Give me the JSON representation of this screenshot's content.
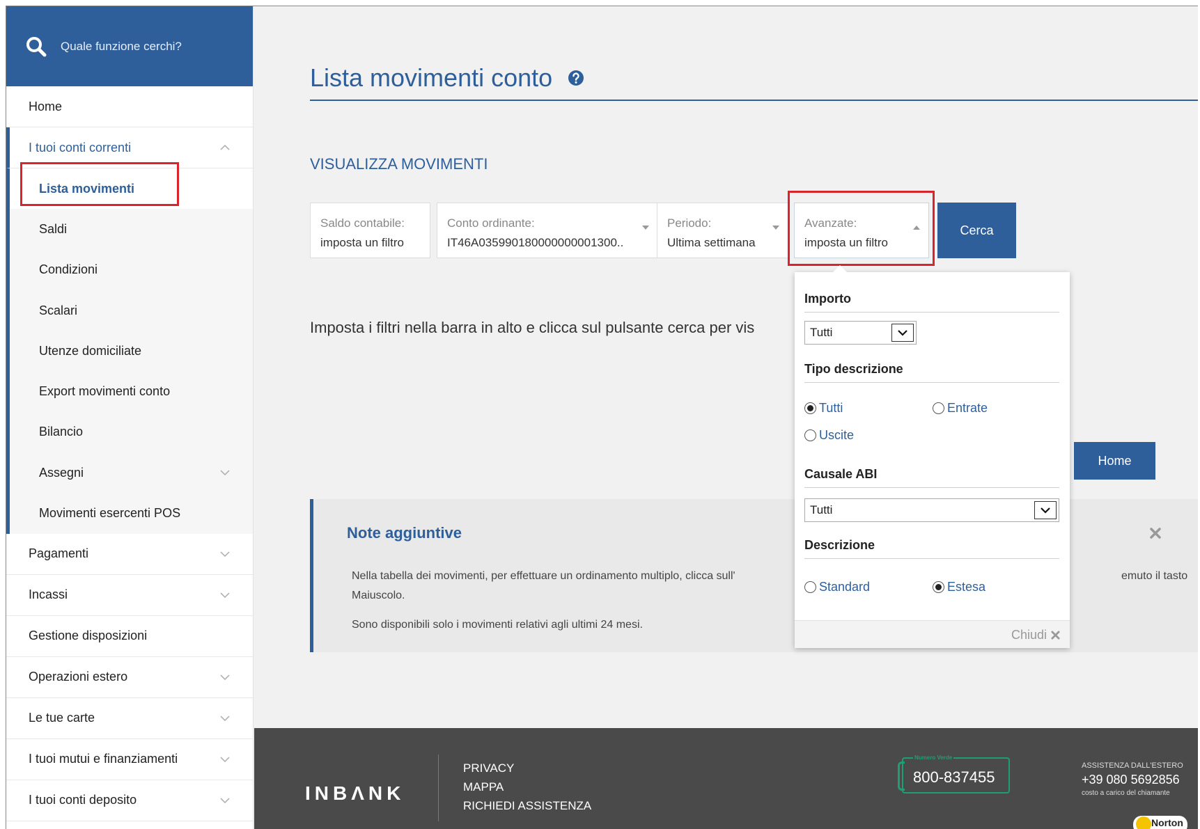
{
  "sidebar": {
    "search_label": "Quale funzione cerchi?",
    "items": [
      {
        "label": "Home"
      },
      {
        "label": "I tuoi conti correnti"
      },
      {
        "label": "Pagamenti"
      },
      {
        "label": "Incassi"
      },
      {
        "label": "Gestione disposizioni"
      },
      {
        "label": "Operazioni estero"
      },
      {
        "label": "Le tue carte"
      },
      {
        "label": "I tuoi mutui e finanziamenti"
      },
      {
        "label": "I tuoi conti deposito"
      }
    ],
    "sub_items": [
      {
        "label": "Lista movimenti"
      },
      {
        "label": "Saldi"
      },
      {
        "label": "Condizioni"
      },
      {
        "label": "Scalari"
      },
      {
        "label": "Utenze domiciliate"
      },
      {
        "label": "Export movimenti conto"
      },
      {
        "label": "Bilancio"
      },
      {
        "label": "Assegni"
      },
      {
        "label": "Movimenti esercenti POS"
      }
    ]
  },
  "main": {
    "title": "Lista movimenti conto",
    "section_title": "VISUALIZZA MOVIMENTI",
    "filters": [
      {
        "label": "Saldo contabile:",
        "value": "imposta un filtro"
      },
      {
        "label": "Conto ordinante:",
        "value": "IT46A035990180000000001300.."
      },
      {
        "label": "Periodo:",
        "value": "Ultima settimana"
      },
      {
        "label": "Avanzate:",
        "value": "imposta un filtro"
      }
    ],
    "search_button": "Cerca",
    "instructions": "Imposta i filtri nella barra in alto e clicca sul pulsante cerca per vis",
    "home_button": "Home"
  },
  "notes": {
    "title": "Note aggiuntive",
    "line1": "Nella tabella dei movimenti, per effettuare un ordinamento multiplo, clicca sull'",
    "line1_end": "emuto il tasto",
    "line2": "Maiuscolo.",
    "line3": "Sono disponibili solo i movimenti relativi agli ultimi 24 mesi."
  },
  "panel": {
    "importo_title": "Importo",
    "importo_value": "Tutti",
    "tipo_title": "Tipo descrizione",
    "tipo_options": [
      "Tutti",
      "Entrate",
      "Uscite"
    ],
    "causale_title": "Causale ABI",
    "causale_value": "Tutti",
    "descrizione_title": "Descrizione",
    "descrizione_options": [
      "Standard",
      "Estesa"
    ],
    "close_label": "Chiudi"
  },
  "footer": {
    "logo": "INBΛNK",
    "links": [
      "PRIVACY",
      "MAPPA",
      "RICHIEDI ASSISTENZA"
    ],
    "tollfree_tag": "Numero Verde",
    "tollfree_number": "800-837455",
    "intl_label": "ASSISTENZA DALL'ESTERO",
    "intl_number": "+39 080 5692856",
    "intl_cost": "costo a carico del chiamante",
    "norton": "Norton"
  },
  "colors": {
    "brand": "#2e5f9a",
    "highlight": "#d9232d",
    "footer_bg": "#4a4a4a",
    "tollfree": "#1e9e72"
  }
}
